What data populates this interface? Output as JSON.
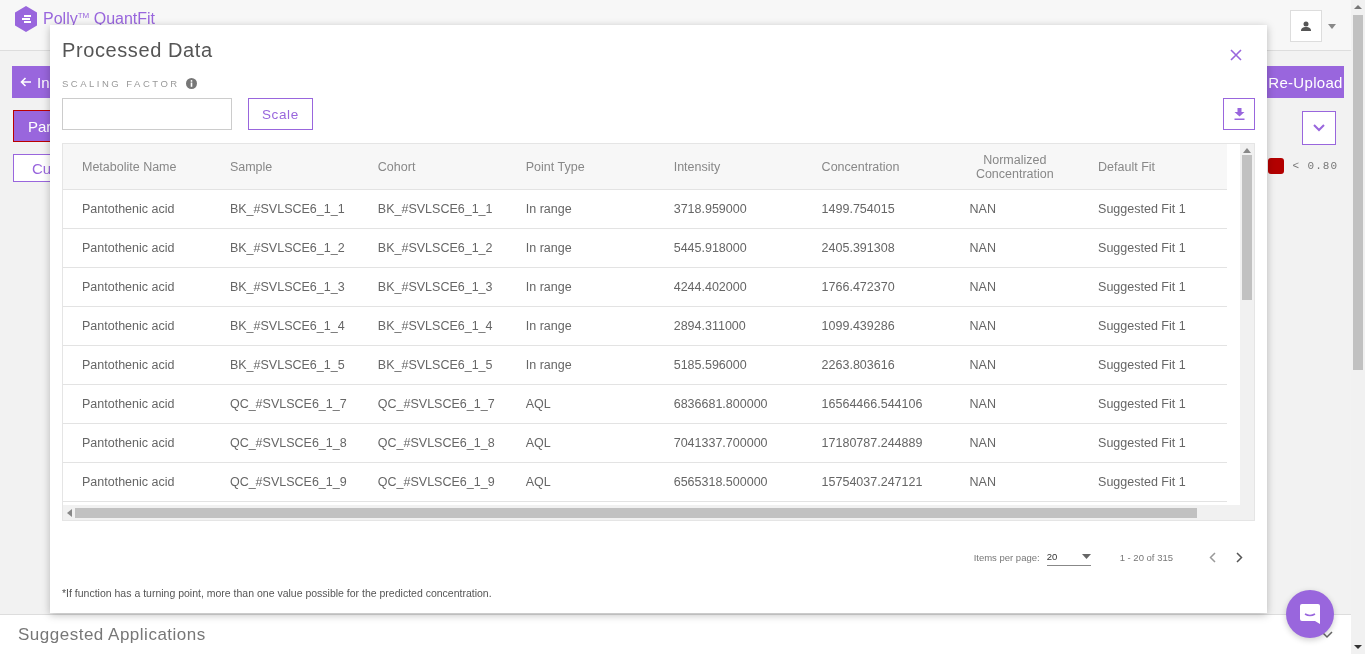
{
  "app": {
    "logo_text": "Polly$^{TM}$ QuantFit",
    "back_button": "In",
    "primary_button": "Par",
    "outline_button": "Cu",
    "reupload_button": "Re-Upload",
    "legend": [
      {
        "label": "< 0.80",
        "color": "#b30000"
      }
    ],
    "suggested_applications": "Suggested Applications"
  },
  "dialog": {
    "title": "Processed Data",
    "scaling_label": "SCALING FACTOR",
    "scale_button": "Scale",
    "table": {
      "columns": [
        "Metabolite Name",
        "Sample",
        "Cohort",
        "Point Type",
        "Intensity",
        "Concentration",
        "Normalized Concentration",
        "Default Fit"
      ],
      "rows": [
        [
          "Pantothenic acid",
          "BK_#SVLSCE6_1_1",
          "BK_#SVLSCE6_1_1",
          "In range",
          "3718.959000",
          "1499.754015",
          "NAN",
          "Suggested Fit 1"
        ],
        [
          "Pantothenic acid",
          "BK_#SVLSCE6_1_2",
          "BK_#SVLSCE6_1_2",
          "In range",
          "5445.918000",
          "2405.391308",
          "NAN",
          "Suggested Fit 1"
        ],
        [
          "Pantothenic acid",
          "BK_#SVLSCE6_1_3",
          "BK_#SVLSCE6_1_3",
          "In range",
          "4244.402000",
          "1766.472370",
          "NAN",
          "Suggested Fit 1"
        ],
        [
          "Pantothenic acid",
          "BK_#SVLSCE6_1_4",
          "BK_#SVLSCE6_1_4",
          "In range",
          "2894.311000",
          "1099.439286",
          "NAN",
          "Suggested Fit 1"
        ],
        [
          "Pantothenic acid",
          "BK_#SVLSCE6_1_5",
          "BK_#SVLSCE6_1_5",
          "In range",
          "5185.596000",
          "2263.803616",
          "NAN",
          "Suggested Fit 1"
        ],
        [
          "Pantothenic acid",
          "QC_#SVLSCE6_1_7",
          "QC_#SVLSCE6_1_7",
          "AQL",
          "6836681.800000",
          "16564466.544106",
          "NAN",
          "Suggested Fit 1"
        ],
        [
          "Pantothenic acid",
          "QC_#SVLSCE6_1_8",
          "QC_#SVLSCE6_1_8",
          "AQL",
          "7041337.700000",
          "17180787.244889",
          "NAN",
          "Suggested Fit 1"
        ],
        [
          "Pantothenic acid",
          "QC_#SVLSCE6_1_9",
          "QC_#SVLSCE6_1_9",
          "AQL",
          "6565318.500000",
          "15754037.247121",
          "NAN",
          "Suggested Fit 1"
        ]
      ]
    },
    "pagination": {
      "items_per_page_label": "Items per page:",
      "items_per_page": "20",
      "range": "1 - 20 of 315"
    },
    "footnote": "*If function has a turning point, more than one value possible for the predicted concentration."
  }
}
